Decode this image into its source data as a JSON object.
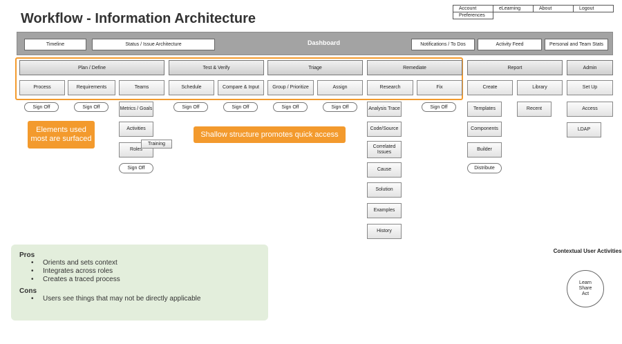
{
  "title": "Workflow - Information Architecture",
  "top_nav": [
    "Account",
    "eLearning",
    "About",
    "Logout",
    "Preferences"
  ],
  "dashboard_bar": {
    "items": [
      "Timeline",
      "Status / Issue Architecture",
      "Notifications / To Dos",
      "Activity Feed",
      "Personal and Team Stats"
    ],
    "center_label": "Dashboard"
  },
  "sections": {
    "plan": "Plan / Define",
    "test": "Test & Verify",
    "triage": "Triage",
    "remediate": "Remediate",
    "report": "Report",
    "admin": "Admin"
  },
  "subitems": {
    "process": "Process",
    "requirements": "Requirements",
    "teams": "Teams",
    "schedule": "Schedule",
    "compare": "Compare & Input",
    "group": "Group / Prioritize",
    "assign": "Assign",
    "research": "Research",
    "fix": "Fix",
    "create": "Create",
    "library": "Library",
    "setup": "Set Up"
  },
  "sign_off": "Sign Off",
  "teams_children": [
    "Metrics / Goals",
    "Activities",
    "Roles",
    "Training"
  ],
  "research_children": [
    "Analysis Trace",
    "Code/Source",
    "Correlated Issues",
    "Cause",
    "Solution",
    "Examples",
    "History"
  ],
  "create_children": [
    "Templates",
    "Components",
    "Builder",
    "Distribute"
  ],
  "library_children": [
    "Recent"
  ],
  "admin_children": [
    "Access",
    "LDAP"
  ],
  "callouts": {
    "surfaced": "Elements used most are surfaced",
    "shallow": "Shallow structure promotes quick access"
  },
  "pros": {
    "pros_title": "Pros",
    "pros_items": [
      "Orients and sets context",
      "Integrates across roles",
      "Creates a traced process"
    ],
    "cons_title": "Cons",
    "cons_items": [
      "Users see things that may not be directly applicable"
    ]
  },
  "contextual": {
    "title": "Contextual User Activities",
    "circle": [
      "Learn",
      "Share",
      "Act"
    ]
  },
  "colors": {
    "accent": "#f39a2d",
    "bar": "#a3a3a3",
    "pros_bg": "#e3eedc"
  }
}
